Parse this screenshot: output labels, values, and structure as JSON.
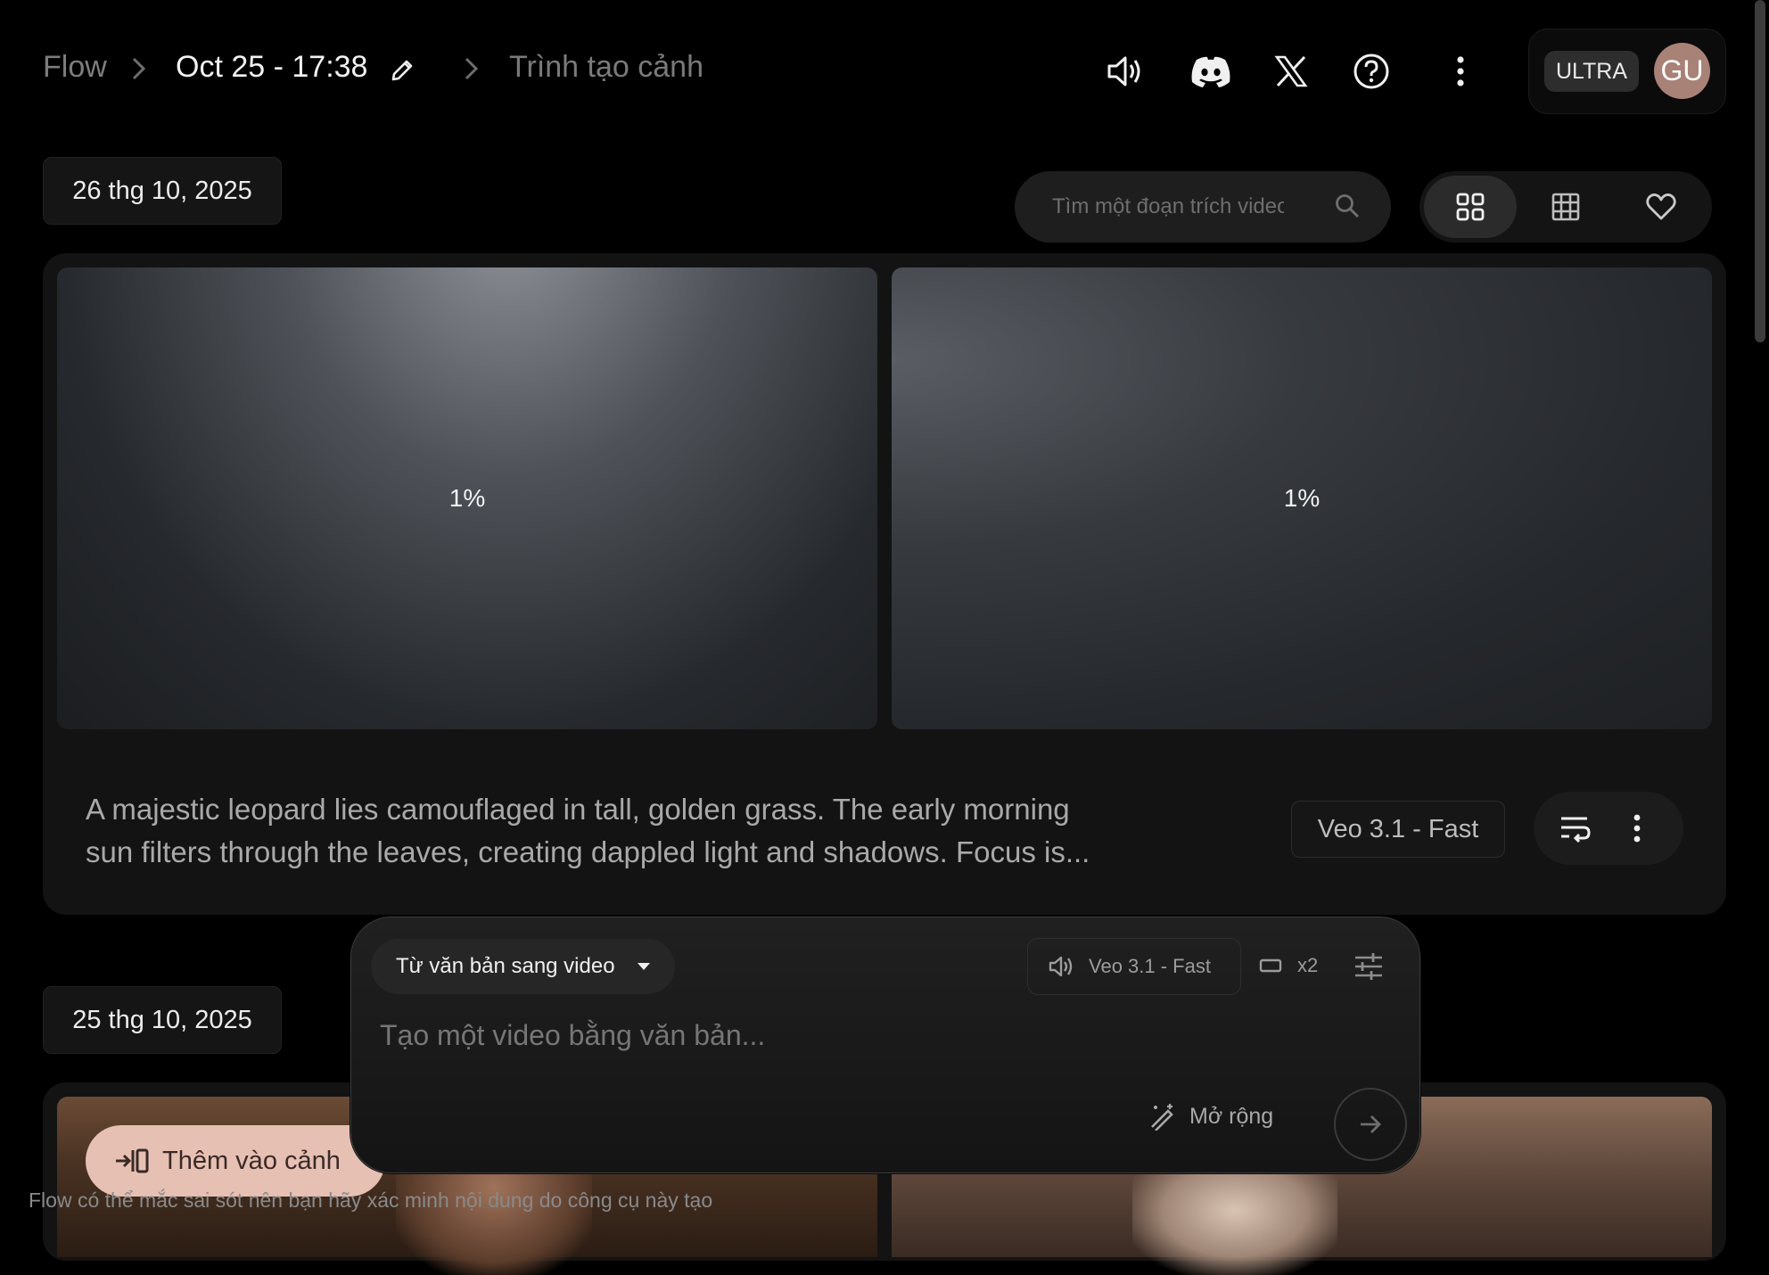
{
  "breadcrumb": {
    "root": "Flow",
    "project_title": "Oct 25 - 17:38",
    "current": "Trình tạo cảnh"
  },
  "account": {
    "plan_badge": "ULTRA",
    "avatar_initials": "GU"
  },
  "toolbar": {
    "search_placeholder": "Tìm một đoạn trích video",
    "view_modes": [
      "grid-large",
      "grid-small",
      "favorites"
    ],
    "active_view": "grid-large"
  },
  "groups": [
    {
      "date_label": "26 thg 10, 2025",
      "clips": [
        {
          "progress_label": "1%"
        },
        {
          "progress_label": "1%"
        }
      ],
      "prompt": "A majestic leopard lies camouflaged in tall, golden grass. The early morning sun filters through the leaves, creating dappled light and shadows. Focus is...",
      "model": "Veo 3.1 - Fast"
    },
    {
      "date_label": "25 thg 10, 2025",
      "add_to_scene_label": "Thêm vào cảnh"
    }
  ],
  "composer": {
    "mode": "Từ văn bản sang video",
    "model": "Veo 3.1 - Fast",
    "output_count": "x2",
    "prompt_placeholder": "Tạo một video bằng văn bản...",
    "expand_label": "Mở rộng"
  },
  "disclaimer": "Flow có thể mắc sai sót nên bạn hãy xác minh nội dung do công cụ này tạo",
  "colors": {
    "background": "#000000",
    "card": "#131313",
    "accent_button": "#e7c0b4",
    "avatar": "#a88276"
  }
}
